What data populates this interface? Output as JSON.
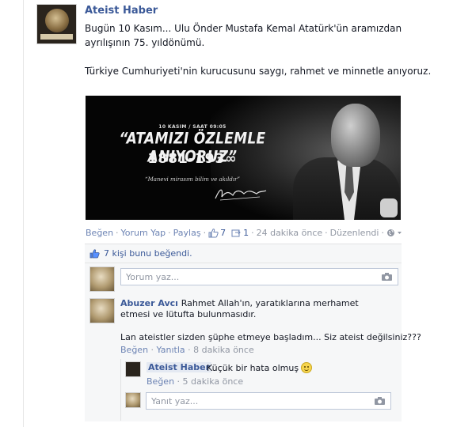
{
  "post": {
    "author": "Ateist Haber",
    "avatar_icon": "page-logo-icon",
    "text_line1": "Bugün 10 Kasım... Ulu Önder Mustafa Kemal Atatürk'ün aramızdan",
    "text_line2": "ayrılışının 75. yıldönümü.",
    "text_line3": "Türkiye Cumhuriyeti'nin kurucusunu saygı, rahmet ve minnetle anıyoruz."
  },
  "banner": {
    "date": "10 KASIM / SAAT 09:05",
    "title": "“ATAMIZI ÖZLEMLE ANIYORUZ”",
    "years": "1881-193∞",
    "quote": "“Manevi mirasım bilim ve akıldır”"
  },
  "actions": {
    "like": "Beğen",
    "comment": "Yorum Yap",
    "share": "Paylaş",
    "like_count": "7",
    "share_count": "1",
    "time": "24 dakika önce",
    "edited": "Düzenlendi",
    "separator": "·",
    "like_icon": "thumbs-up-icon",
    "share_icon": "share-icon",
    "privacy_icon": "globe-icon"
  },
  "likes_summary": "7 kişi bunu beğendi.",
  "compose": {
    "comment_placeholder": "Yorum yaz...",
    "reply_placeholder": "Yanıt yaz...",
    "camera_icon": "camera-icon"
  },
  "comment": {
    "author": "Abuzer Avcı",
    "text1": "Rahmet Allah'ın, yaratıklarına merhamet etmesi ve lütufta bulunmasıdır.",
    "text2": "Lan ateistler sizden şüphe etmeye başladım... Siz ateist değilsiniz???",
    "like": "Beğen",
    "reply": "Yanıtla",
    "time": "8 dakika önce"
  },
  "reply": {
    "author": "Ateist Haber",
    "text": "Küçük bir hata olmuş",
    "emoji_icon": "smiley-icon",
    "like": "Beğen",
    "time": "5 dakika önce"
  },
  "colors": {
    "link": "#3b5998",
    "meta_link": "#6d84b4",
    "gray": "#9197a3",
    "feedback_bg": "#f6f7f8"
  }
}
